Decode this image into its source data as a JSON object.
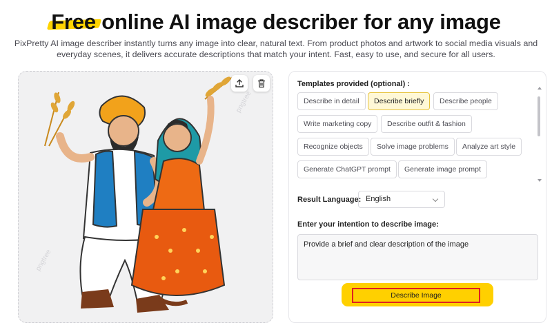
{
  "hero": {
    "highlight": "Free",
    "title_rest": " online AI image describer for any image",
    "subtitle": "PixPretty AI image describer instantly turns any image into clear, natural text. From product photos and artwork to social media visuals and everyday scenes, it delivers accurate descriptions that match your intent. Fast, easy to use, and secure for all users."
  },
  "image_panel": {
    "tools": [
      "upload-icon",
      "trash-icon"
    ],
    "watermark": "pngtree"
  },
  "templates": {
    "label": "Templates provided (optional) :",
    "items": [
      {
        "label": "Describe in detail",
        "active": false
      },
      {
        "label": "Describe briefly",
        "active": true
      },
      {
        "label": "Describe people",
        "active": false
      },
      {
        "label": "Write marketing copy",
        "active": false
      },
      {
        "label": "Describe outfit & fashion",
        "active": false
      },
      {
        "label": "Recognize objects",
        "active": false
      },
      {
        "label": "Solve image problems",
        "active": false
      },
      {
        "label": "Analyze art style",
        "active": false
      },
      {
        "label": "Generate ChatGPT prompt",
        "active": false
      },
      {
        "label": "Generate image prompt",
        "active": false
      }
    ]
  },
  "language": {
    "label": "Result Language:",
    "value": "English"
  },
  "intention": {
    "label": "Enter your intention to describe image:",
    "value": "Provide a brief and clear description of the image"
  },
  "action": {
    "button_label": "Describe Image"
  },
  "colors": {
    "accent": "#ffd000",
    "highlight": "#ffd400",
    "active_chip_bg": "#fff8d6",
    "focus_outline": "#e02020"
  }
}
